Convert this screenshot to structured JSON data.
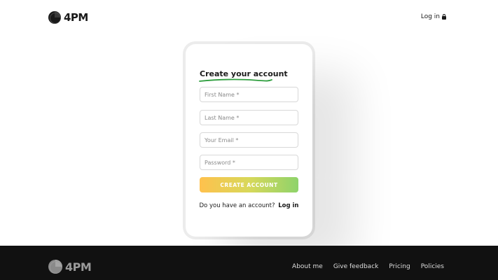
{
  "header": {
    "logo_text": "4PM",
    "login_label": "Log in",
    "login_icon": "lock-icon"
  },
  "form": {
    "title": "Create your account",
    "underline_color": "#2e9e3e",
    "fields": {
      "first_name_placeholder": "First Name *",
      "last_name_placeholder": "Last Name *",
      "email_placeholder": "Your Email *",
      "password_placeholder": "Password *"
    },
    "submit_label": "CREATE ACCOUNT",
    "gradient_colors": [
      "#ffc14d",
      "#8ed36b"
    ],
    "account_prompt": "Do you have an account?",
    "login_label": "Log in"
  },
  "footer": {
    "logo_text": "4PM",
    "nav": [
      "About me",
      "Give feedback",
      "Pricing",
      "Policies"
    ]
  }
}
